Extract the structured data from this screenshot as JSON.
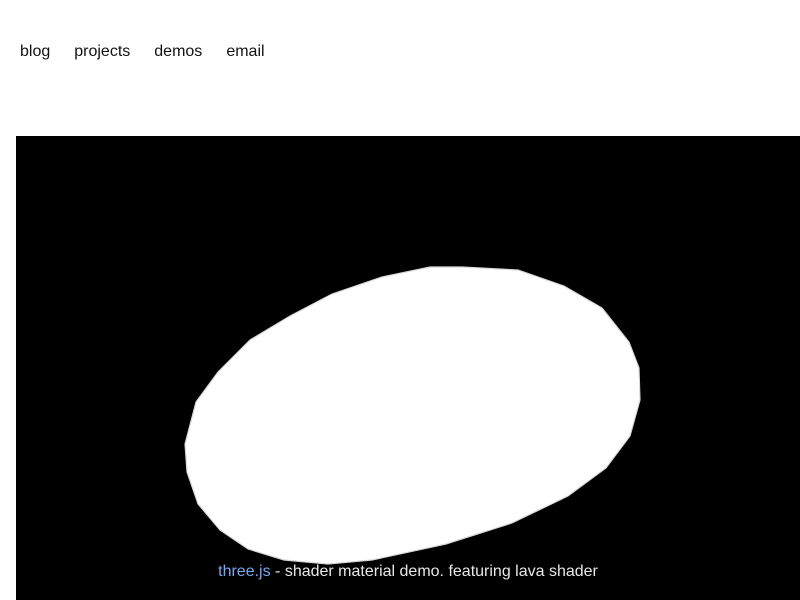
{
  "nav": {
    "items": [
      {
        "label": "blog"
      },
      {
        "label": "projects"
      },
      {
        "label": "demos"
      },
      {
        "label": "email"
      }
    ]
  },
  "demo": {
    "link_label": "three.js",
    "caption_text": " - shader material demo. featuring lava shader",
    "link_color": "#7aa7f0",
    "canvas_background": "#000000",
    "shape_color": "#ffffff"
  }
}
